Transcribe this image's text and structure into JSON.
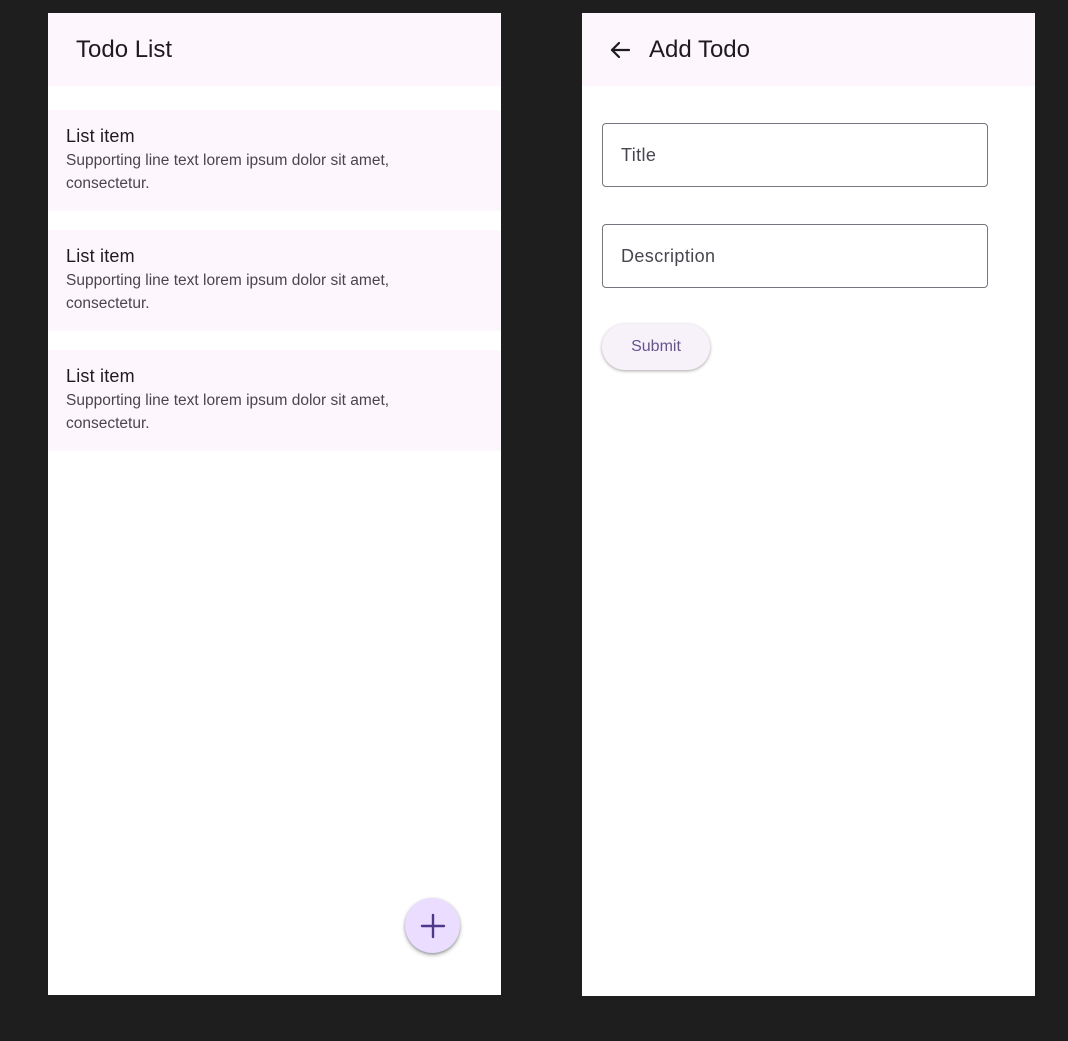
{
  "screens": {
    "list": {
      "app_bar": {
        "title": "Todo List"
      },
      "items": [
        {
          "headline": "List item",
          "supporting": "Supporting line text lorem ipsum dolor sit amet, consectetur."
        },
        {
          "headline": "List item",
          "supporting": "Supporting line text lorem ipsum dolor sit amet, consectetur."
        },
        {
          "headline": "List item",
          "supporting": "Supporting line text lorem ipsum dolor sit amet, consectetur."
        }
      ],
      "fab": {
        "icon": "add-icon"
      }
    },
    "add": {
      "app_bar": {
        "title": "Add Todo",
        "back_icon": "arrow-back-icon"
      },
      "fields": {
        "title_placeholder": "Title",
        "description_placeholder": "Description"
      },
      "submit_label": "Submit"
    }
  },
  "colors": {
    "canvas_bg": "#1e1e1e",
    "surface_container": "#fdf6fd",
    "fab_bg": "#eaddff",
    "primary_text": "#1d1b20",
    "secondary_text": "#49454f",
    "accent": "#65558f",
    "outline": "#79747e"
  }
}
